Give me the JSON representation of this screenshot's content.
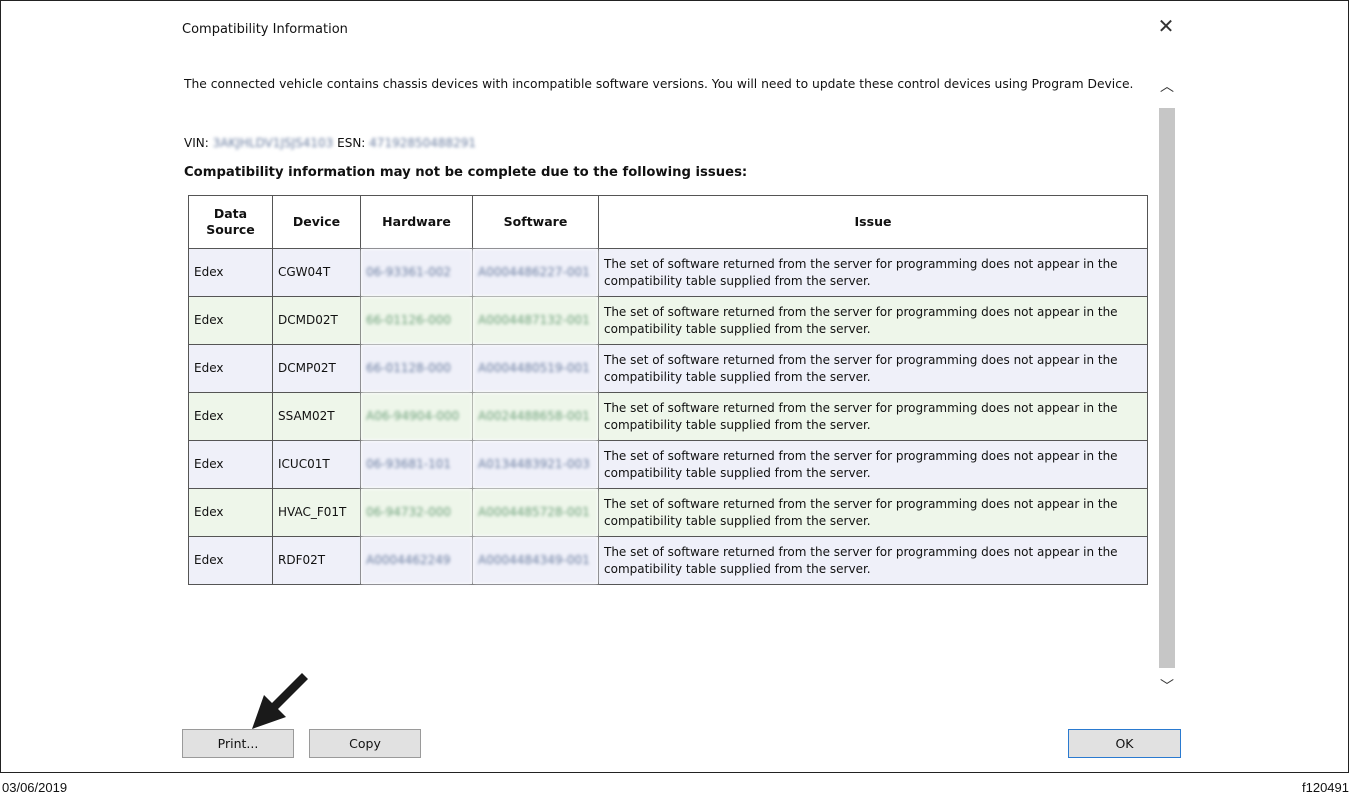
{
  "dialog": {
    "title": "Compatibility Information",
    "close_icon": "close-icon",
    "intro": "The connected vehicle contains chassis devices with incompatible software versions. You will need to update these control devices using Program Device.",
    "vin_label": "VIN:",
    "vin_value": "3AKJHLDV1JSJS4103",
    "esn_label": "ESN:",
    "esn_value": "471928504882​91",
    "issues_heading": "Compatibility information may not be complete due to the following issues:",
    "table": {
      "headers": [
        "Data Source",
        "Device",
        "Hardware",
        "Software",
        "Issue"
      ],
      "rows": [
        {
          "source": "Edex",
          "device": "CGW04T",
          "hardware": "06-93361-002",
          "software": "A0004486227-001",
          "issue": "The set of software returned from the server for programming does not appear in the compatibility table supplied from the server."
        },
        {
          "source": "Edex",
          "device": "DCMD02T",
          "hardware": "66-01126-000",
          "software": "A0004487132-001",
          "issue": "The set of software returned from the server for programming does not appear in the compatibility table supplied from the server."
        },
        {
          "source": "Edex",
          "device": "DCMP02T",
          "hardware": "66-01128-000",
          "software": "A0004480519-001",
          "issue": "The set of software returned from the server for programming does not appear in the compatibility table supplied from the server."
        },
        {
          "source": "Edex",
          "device": "SSAM02T",
          "hardware": "A06-94904-000",
          "software": "A0024488658-001",
          "issue": "The set of software returned from the server for programming does not appear in the compatibility table supplied from the server."
        },
        {
          "source": "Edex",
          "device": "ICUC01T",
          "hardware": "06-93681-101",
          "software": "A0134483921-003",
          "issue": "The set of software returned from the server for programming does not appear in the compatibility table supplied from the server."
        },
        {
          "source": "Edex",
          "device": "HVAC_F01T",
          "hardware": "06-94732-000",
          "software": "A0004485728-001",
          "issue": "The set of software returned from the server for programming does not appear in the compatibility table supplied from the server."
        },
        {
          "source": "Edex",
          "device": "RDF02T",
          "hardware": "A0004462249",
          "software": "A0004484349-001",
          "issue": "The set of software returned from the server for programming does not appear in the compatibility table supplied from the server."
        }
      ]
    },
    "buttons": {
      "print": "Print...",
      "copy": "Copy",
      "ok": "OK"
    },
    "scroll_up_icon": "chevron-up-icon",
    "scroll_down_icon": "chevron-down-icon"
  },
  "callout": {
    "icon": "arrow-pointer-icon"
  },
  "footer": {
    "date": "03/06/2019",
    "code": "f120491"
  }
}
